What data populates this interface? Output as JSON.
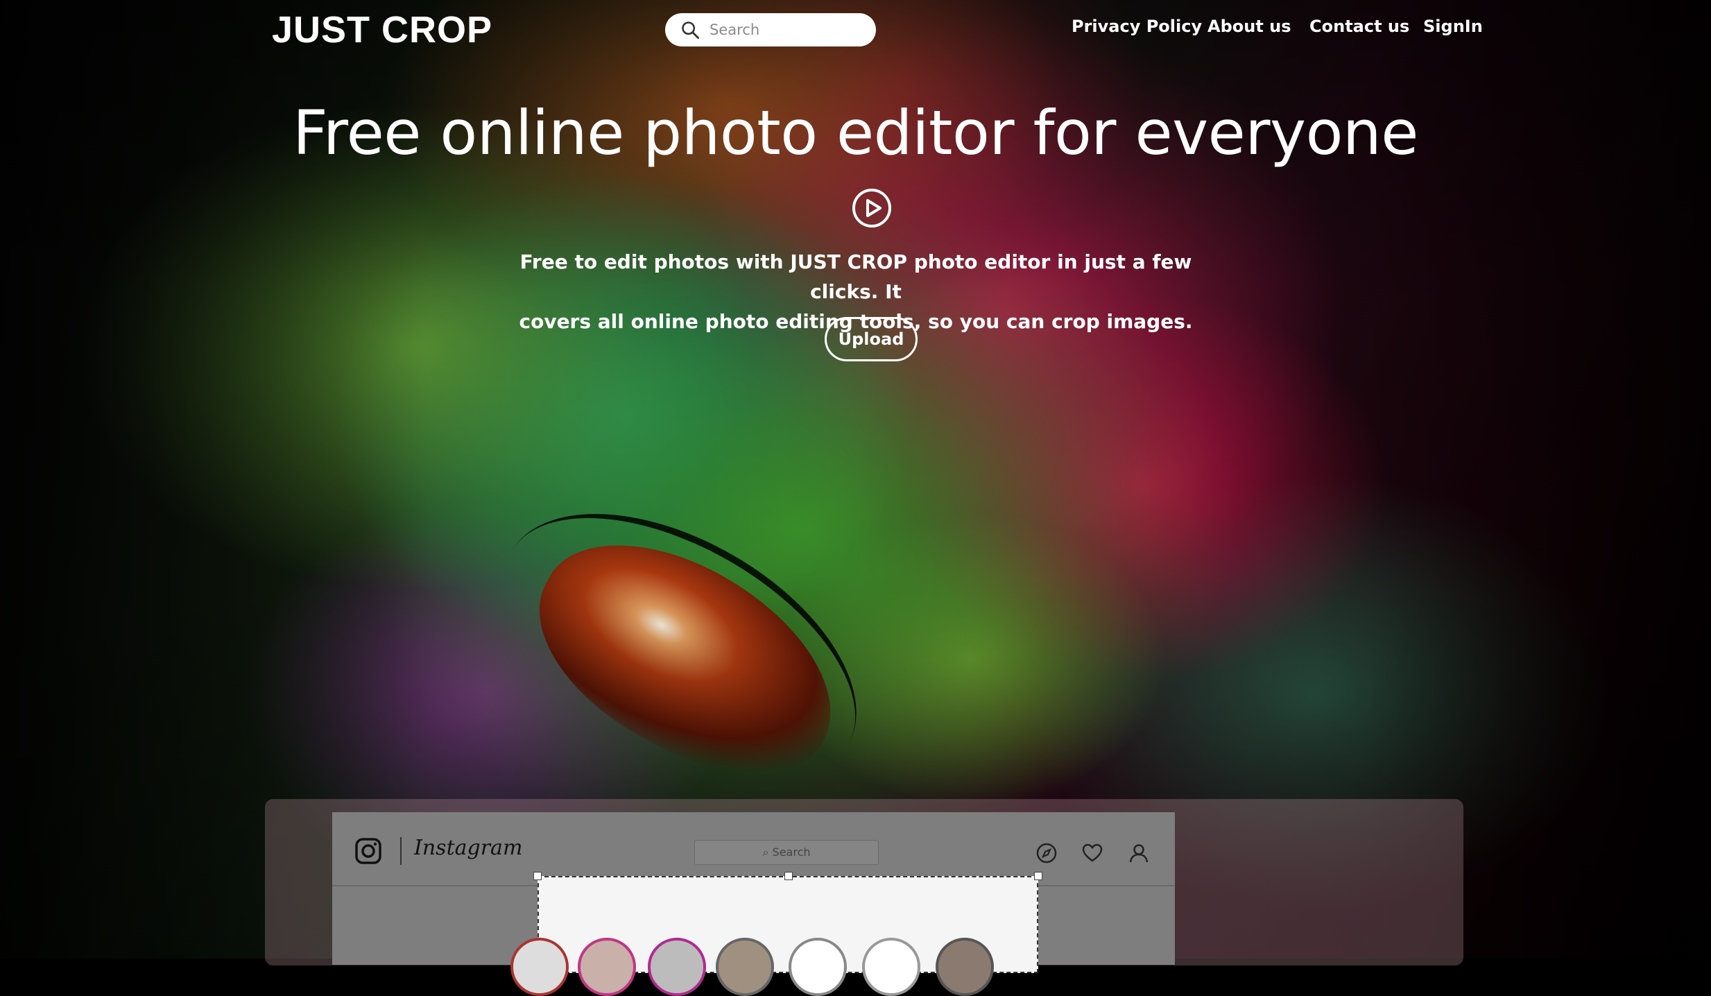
{
  "header": {
    "logo": "JUST CROP",
    "search_placeholder": "Search",
    "nav": [
      "Privacy Policy",
      "About us",
      "Contact us",
      "SignIn"
    ]
  },
  "hero": {
    "title": "Free online photo editor for everyone",
    "subtitle_line1": "Free to edit photos with JUST CROP photo editor in just a few clicks. It",
    "subtitle_line2": "covers all online photo editing tools, so you can crop images.",
    "upload_label": "Upload"
  },
  "preview": {
    "app_name": "Instagram",
    "search_placeholder": "Search"
  },
  "colors": {
    "accent": "#ffffff",
    "story_ring": "#c13584"
  }
}
